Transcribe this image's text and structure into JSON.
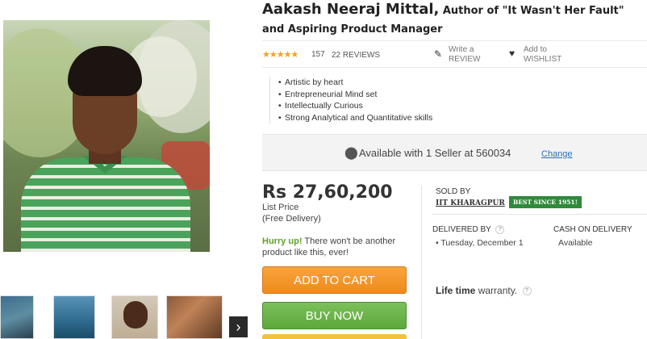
{
  "product": {
    "name": "Aakash Neeraj Mittal,",
    "role_line1": "Author of \"It Wasn't Her Fault\"",
    "role_line2": "and Aspiring Product Manager"
  },
  "rating": {
    "stars": "★★★★★",
    "count": "157",
    "reviews": "22 REVIEWS",
    "write_review": [
      "Write a",
      "REVIEW"
    ],
    "wishlist": [
      "Add to",
      "WISHLIST"
    ]
  },
  "highlights": [
    "Artistic by heart",
    "Entrepreneurial Mind set",
    "Intellectually Curious",
    "Strong Analytical and Quantitative skills"
  ],
  "availability": {
    "text": "Available with 1 Seller at 560034",
    "change": "Change"
  },
  "pricing": {
    "price": "Rs 27,60,200",
    "list_price": "List Price",
    "free_delivery": "(Free Delivery)",
    "hurry_em": "Hurry up!",
    "hurry_rest": "There won't be another product like this, ever!"
  },
  "buttons": {
    "add_to_cart": "ADD TO CART",
    "buy_now": "BUY NOW"
  },
  "seller": {
    "sold_by_label": "SOLD BY",
    "name": "IIT KHARAGPUR",
    "badge": "BEST SINCE 1951!"
  },
  "delivery": {
    "label": "DELIVERED BY",
    "date": "Tuesday, December 1",
    "cod_label": "CASH ON DELIVERY",
    "cod_value": "Available",
    "help": "?"
  },
  "warranty": {
    "bold": "Life time",
    "rest": "warranty.",
    "help": "?"
  },
  "gallery": {
    "next": "›"
  },
  "colors": {
    "cart_orange": "#ef8a1a",
    "buy_green": "#5ea83c",
    "badge_green": "#2f8a3a",
    "link_blue": "#2a6ebb",
    "star_gold": "#f0a21a"
  }
}
